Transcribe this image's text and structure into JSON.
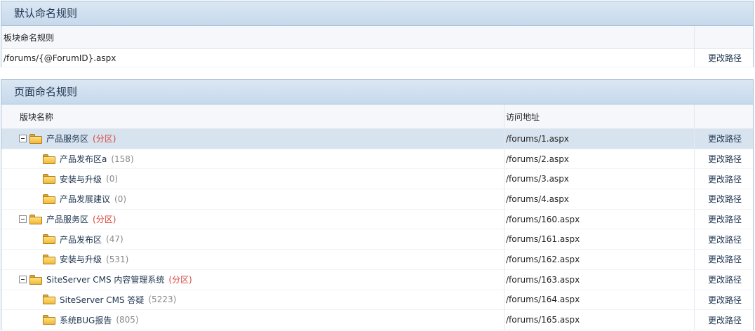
{
  "default_rules": {
    "title": "默认命名规则",
    "header_label": "板块命名规则",
    "rule_value": "/forums/{@ForumID}.aspx",
    "action_label": "更改路径"
  },
  "page_rules": {
    "title": "页面命名规则",
    "col_name": "版块名称",
    "col_address": "访问地址",
    "rows": [
      {
        "name": "产品服务区",
        "note": "(分区)",
        "address": "/forums/1.aspx",
        "action": "更改路径"
      },
      {
        "name": "产品发布区a",
        "count": "(158)",
        "address": "/forums/2.aspx",
        "action": "更改路径"
      },
      {
        "name": "安装与升级",
        "count": "(0)",
        "address": "/forums/3.aspx",
        "action": "更改路径"
      },
      {
        "name": "产品发展建议",
        "count": "(0)",
        "address": "/forums/4.aspx",
        "action": "更改路径"
      },
      {
        "name": "产品服务区",
        "note": "(分区)",
        "address": "/forums/160.aspx",
        "action": "更改路径"
      },
      {
        "name": "产品发布区",
        "count": "(47)",
        "address": "/forums/161.aspx",
        "action": "更改路径"
      },
      {
        "name": "安装与升级",
        "count": "(531)",
        "address": "/forums/162.aspx",
        "action": "更改路径"
      },
      {
        "name": "SiteServer CMS 内容管理系统",
        "note": "(分区)",
        "address": "/forums/163.aspx",
        "action": "更改路径"
      },
      {
        "name": "SiteServer CMS 答疑",
        "count": "(5223)",
        "address": "/forums/164.aspx",
        "action": "更改路径"
      },
      {
        "name": "系统BUG报告",
        "count": "(805)",
        "address": "/forums/165.aspx",
        "action": "更改路径"
      }
    ]
  },
  "colors": {
    "title_bar": "#c6d9ec",
    "border": "#a9c1d9",
    "selected_row": "#d7e3ef",
    "section_note": "#d9443b",
    "count_text": "#888888",
    "link_text": "#1f3550"
  }
}
